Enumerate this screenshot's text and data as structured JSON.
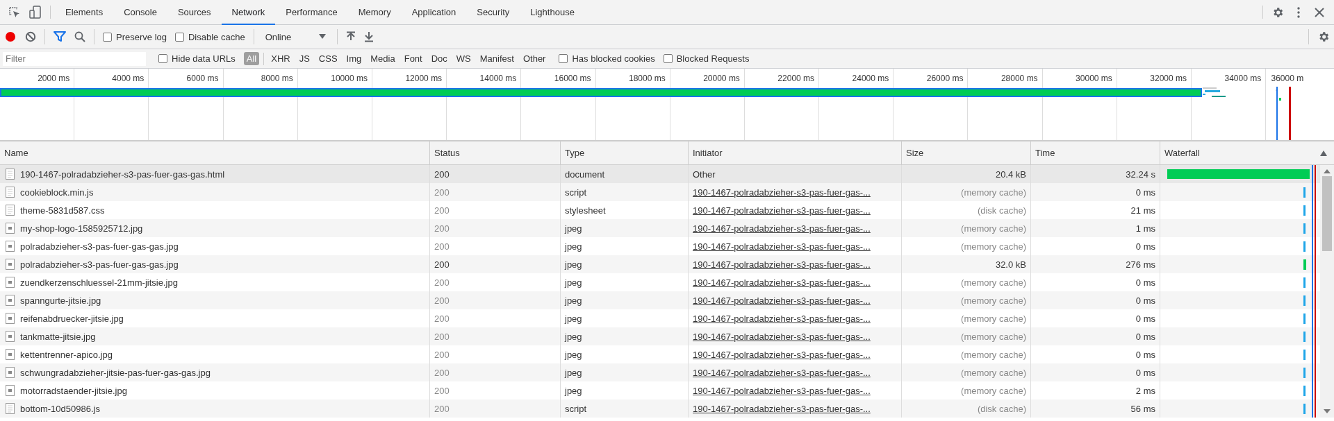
{
  "tabs": [
    {
      "label": "Elements",
      "selected": false
    },
    {
      "label": "Console",
      "selected": false
    },
    {
      "label": "Sources",
      "selected": false
    },
    {
      "label": "Network",
      "selected": true
    },
    {
      "label": "Performance",
      "selected": false
    },
    {
      "label": "Memory",
      "selected": false
    },
    {
      "label": "Application",
      "selected": false
    },
    {
      "label": "Security",
      "selected": false
    },
    {
      "label": "Lighthouse",
      "selected": false
    }
  ],
  "toolbar": {
    "recording": true,
    "filter_active": true,
    "checkboxes": [
      {
        "label": "Preserve log",
        "checked": false
      },
      {
        "label": "Disable cache",
        "checked": false
      }
    ],
    "throttling": "Online"
  },
  "filter_bar": {
    "placeholder": "Filter",
    "hide_data_urls": {
      "label": "Hide data URLs",
      "checked": false
    },
    "types": [
      {
        "label": "All",
        "selected": true
      },
      {
        "label": "XHR",
        "selected": false
      },
      {
        "label": "JS",
        "selected": false
      },
      {
        "label": "CSS",
        "selected": false
      },
      {
        "label": "Img",
        "selected": false
      },
      {
        "label": "Media",
        "selected": false
      },
      {
        "label": "Font",
        "selected": false
      },
      {
        "label": "Doc",
        "selected": false
      },
      {
        "label": "WS",
        "selected": false
      },
      {
        "label": "Manifest",
        "selected": false
      },
      {
        "label": "Other",
        "selected": false
      }
    ],
    "checkboxes": [
      {
        "label": "Has blocked cookies",
        "checked": false
      },
      {
        "label": "Blocked Requests",
        "checked": false
      }
    ]
  },
  "overview": {
    "ticks": [
      "2000 ms",
      "4000 ms",
      "6000 ms",
      "8000 ms",
      "10000 ms",
      "12000 ms",
      "14000 ms",
      "16000 ms",
      "18000 ms",
      "20000 ms",
      "22000 ms",
      "24000 ms",
      "26000 ms",
      "28000 ms",
      "30000 ms",
      "32000 ms",
      "34000 ms",
      "36000 m"
    ]
  },
  "table": {
    "columns": [
      "Name",
      "Status",
      "Type",
      "Initiator",
      "Size",
      "Time",
      "Waterfall"
    ],
    "rows": [
      {
        "kind": "document",
        "name": "190-1467-polradabzieher-s3-pas-fuer-gas-gas.html",
        "status": "200",
        "type": "document",
        "initiator": "Other",
        "initiator_link": false,
        "size": "20.4 kB",
        "cached": false,
        "time": "32.24 s",
        "waterfall": {
          "kind": "bar"
        },
        "selected": true
      },
      {
        "kind": "document",
        "name": "cookieblock.min.js",
        "status": "200",
        "type": "script",
        "initiator": "190-1467-polradabzieher-s3-pas-fuer-gas-...",
        "initiator_link": true,
        "size": "(memory cache)",
        "cached": true,
        "time": "0 ms",
        "waterfall": {
          "kind": "tick"
        },
        "selected": false
      },
      {
        "kind": "document",
        "name": "theme-5831d587.css",
        "status": "200",
        "type": "stylesheet",
        "initiator": "190-1467-polradabzieher-s3-pas-fuer-gas-...",
        "initiator_link": true,
        "size": "(disk cache)",
        "cached": true,
        "time": "21 ms",
        "waterfall": {
          "kind": "tick"
        },
        "selected": false
      },
      {
        "kind": "image",
        "name": "my-shop-logo-1585925712.jpg",
        "status": "200",
        "type": "jpeg",
        "initiator": "190-1467-polradabzieher-s3-pas-fuer-gas-...",
        "initiator_link": true,
        "size": "(memory cache)",
        "cached": true,
        "time": "1 ms",
        "waterfall": {
          "kind": "tick"
        },
        "selected": false
      },
      {
        "kind": "image",
        "name": "polradabzieher-s3-pas-fuer-gas-gas.jpg",
        "status": "200",
        "type": "jpeg",
        "initiator": "190-1467-polradabzieher-s3-pas-fuer-gas-...",
        "initiator_link": true,
        "size": "(memory cache)",
        "cached": true,
        "time": "0 ms",
        "waterfall": {
          "kind": "tick"
        },
        "selected": false
      },
      {
        "kind": "image",
        "name": "polradabzieher-s3-pas-fuer-gas-gas.jpg",
        "status": "200",
        "type": "jpeg",
        "initiator": "190-1467-polradabzieher-s3-pas-fuer-gas-...",
        "initiator_link": true,
        "size": "32.0 kB",
        "cached": false,
        "time": "276 ms",
        "waterfall": {
          "kind": "short"
        },
        "selected": false
      },
      {
        "kind": "image",
        "name": "zuendkerzenschluessel-21mm-jitsie.jpg",
        "status": "200",
        "type": "jpeg",
        "initiator": "190-1467-polradabzieher-s3-pas-fuer-gas-...",
        "initiator_link": true,
        "size": "(memory cache)",
        "cached": true,
        "time": "0 ms",
        "waterfall": {
          "kind": "tick"
        },
        "selected": false
      },
      {
        "kind": "image",
        "name": "spanngurte-jitsie.jpg",
        "status": "200",
        "type": "jpeg",
        "initiator": "190-1467-polradabzieher-s3-pas-fuer-gas-...",
        "initiator_link": true,
        "size": "(memory cache)",
        "cached": true,
        "time": "0 ms",
        "waterfall": {
          "kind": "tick"
        },
        "selected": false
      },
      {
        "kind": "image",
        "name": "reifenabdruecker-jitsie.jpg",
        "status": "200",
        "type": "jpeg",
        "initiator": "190-1467-polradabzieher-s3-pas-fuer-gas-...",
        "initiator_link": true,
        "size": "(memory cache)",
        "cached": true,
        "time": "0 ms",
        "waterfall": {
          "kind": "tick"
        },
        "selected": false
      },
      {
        "kind": "image",
        "name": "tankmatte-jitsie.jpg",
        "status": "200",
        "type": "jpeg",
        "initiator": "190-1467-polradabzieher-s3-pas-fuer-gas-...",
        "initiator_link": true,
        "size": "(memory cache)",
        "cached": true,
        "time": "0 ms",
        "waterfall": {
          "kind": "tick"
        },
        "selected": false
      },
      {
        "kind": "image",
        "name": "kettentrenner-apico.jpg",
        "status": "200",
        "type": "jpeg",
        "initiator": "190-1467-polradabzieher-s3-pas-fuer-gas-...",
        "initiator_link": true,
        "size": "(memory cache)",
        "cached": true,
        "time": "0 ms",
        "waterfall": {
          "kind": "tick"
        },
        "selected": false
      },
      {
        "kind": "image",
        "name": "schwungradabzieher-jitsie-pas-fuer-gas-gas.jpg",
        "status": "200",
        "type": "jpeg",
        "initiator": "190-1467-polradabzieher-s3-pas-fuer-gas-...",
        "initiator_link": true,
        "size": "(memory cache)",
        "cached": true,
        "time": "0 ms",
        "waterfall": {
          "kind": "tick"
        },
        "selected": false
      },
      {
        "kind": "image",
        "name": "motorradstaender-jitsie.jpg",
        "status": "200",
        "type": "jpeg",
        "initiator": "190-1467-polradabzieher-s3-pas-fuer-gas-...",
        "initiator_link": true,
        "size": "(memory cache)",
        "cached": true,
        "time": "2 ms",
        "waterfall": {
          "kind": "tick"
        },
        "selected": false
      },
      {
        "kind": "document",
        "name": "bottom-10d50986.js",
        "status": "200",
        "type": "script",
        "initiator": "190-1467-polradabzieher-s3-pas-fuer-gas-...",
        "initiator_link": true,
        "size": "(disk cache)",
        "cached": true,
        "time": "56 ms",
        "waterfall": {
          "kind": "tick"
        },
        "selected": false
      }
    ]
  }
}
